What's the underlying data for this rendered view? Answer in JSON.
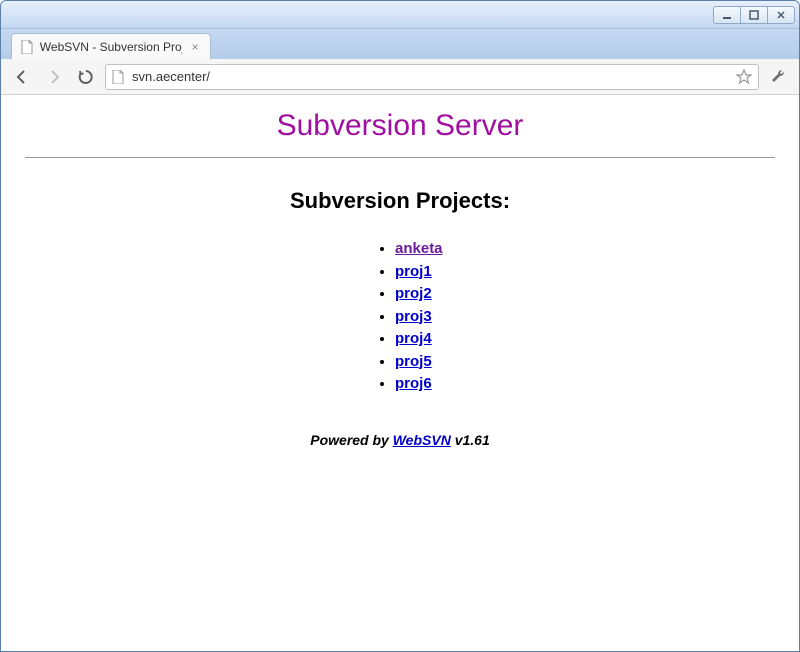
{
  "window": {
    "tab_title": "WebSVN - Subversion Proj",
    "url": "svn.aecenter/"
  },
  "page": {
    "title": "Subversion Server",
    "section_title": "Subversion Projects:",
    "projects": [
      {
        "name": "anketa",
        "visited": true
      },
      {
        "name": "proj1",
        "visited": false
      },
      {
        "name": "proj2",
        "visited": false
      },
      {
        "name": "proj3",
        "visited": false
      },
      {
        "name": "proj4",
        "visited": false
      },
      {
        "name": "proj5",
        "visited": false
      },
      {
        "name": "proj6",
        "visited": false
      }
    ],
    "footer": {
      "prefix": "Powered by ",
      "link_text": "WebSVN",
      "suffix": " v1.61"
    }
  }
}
